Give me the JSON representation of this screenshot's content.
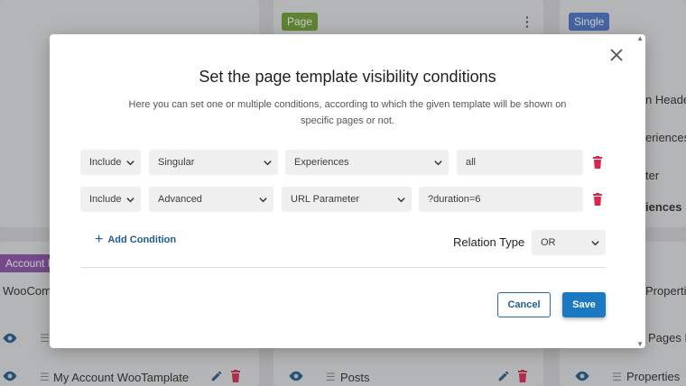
{
  "background": {
    "badges": [
      "Page",
      "Single",
      "Account Pa"
    ],
    "texts": {
      "header": "n Header",
      "experiences": "eriences",
      "ter": "ter",
      "experiences_si": "iences Si",
      "woocom": "WooCom",
      "properties_top": "Properties",
      "pages_h": "Pages H",
      "my_account": "My Account WooTamplate",
      "posts": "Posts",
      "properties_bottom": "Properties"
    },
    "colors": {
      "page_badge": "#6aa02f",
      "single_badge": "#4a74c9",
      "account_badge": "#8a4fa8"
    }
  },
  "modal": {
    "title": "Set the page template visibility conditions",
    "description": "Here you can set one or multiple conditions, according to which the given template will be shown on specific pages or not.",
    "conditions": [
      {
        "mode": "Include",
        "type": "Singular",
        "subject": "Experiences",
        "value": "all"
      },
      {
        "mode": "Include",
        "type": "Advanced",
        "subject": "URL Parameter",
        "value": "?duration=6"
      }
    ],
    "add_condition_label": "Add Condition",
    "relation_type_label": "Relation Type",
    "relation_type_value": "OR",
    "cancel_label": "Cancel",
    "save_label": "Save"
  },
  "icons": {
    "close": "close-icon",
    "chevron": "chevron-down-icon",
    "trash": "trash-icon",
    "plus": "plus-icon",
    "eye": "eye-icon",
    "edit": "pencil-icon"
  },
  "colors": {
    "accent": "#1a79c0",
    "danger": "#d6294f",
    "field_bg": "#f0f0f1"
  }
}
